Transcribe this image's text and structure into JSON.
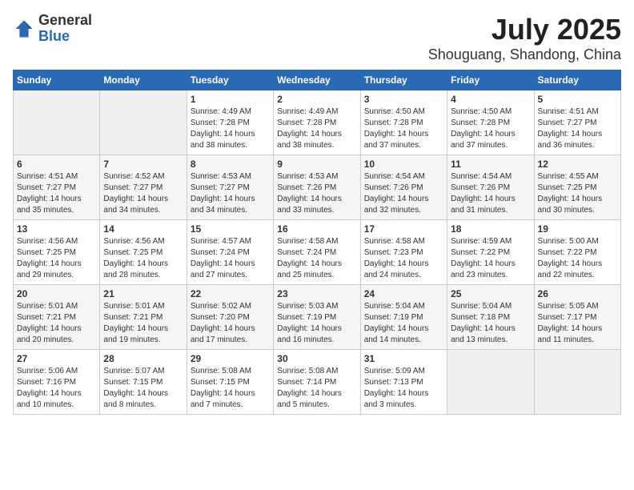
{
  "header": {
    "logo_general": "General",
    "logo_blue": "Blue",
    "title": "July 2025",
    "subtitle": "Shouguang, Shandong, China"
  },
  "days_of_week": [
    "Sunday",
    "Monday",
    "Tuesday",
    "Wednesday",
    "Thursday",
    "Friday",
    "Saturday"
  ],
  "weeks": [
    [
      {
        "day": "",
        "empty": true
      },
      {
        "day": "",
        "empty": true
      },
      {
        "day": "1",
        "sunrise": "Sunrise: 4:49 AM",
        "sunset": "Sunset: 7:28 PM",
        "daylight": "Daylight: 14 hours and 38 minutes."
      },
      {
        "day": "2",
        "sunrise": "Sunrise: 4:49 AM",
        "sunset": "Sunset: 7:28 PM",
        "daylight": "Daylight: 14 hours and 38 minutes."
      },
      {
        "day": "3",
        "sunrise": "Sunrise: 4:50 AM",
        "sunset": "Sunset: 7:28 PM",
        "daylight": "Daylight: 14 hours and 37 minutes."
      },
      {
        "day": "4",
        "sunrise": "Sunrise: 4:50 AM",
        "sunset": "Sunset: 7:28 PM",
        "daylight": "Daylight: 14 hours and 37 minutes."
      },
      {
        "day": "5",
        "sunrise": "Sunrise: 4:51 AM",
        "sunset": "Sunset: 7:27 PM",
        "daylight": "Daylight: 14 hours and 36 minutes."
      }
    ],
    [
      {
        "day": "6",
        "sunrise": "Sunrise: 4:51 AM",
        "sunset": "Sunset: 7:27 PM",
        "daylight": "Daylight: 14 hours and 35 minutes."
      },
      {
        "day": "7",
        "sunrise": "Sunrise: 4:52 AM",
        "sunset": "Sunset: 7:27 PM",
        "daylight": "Daylight: 14 hours and 34 minutes."
      },
      {
        "day": "8",
        "sunrise": "Sunrise: 4:53 AM",
        "sunset": "Sunset: 7:27 PM",
        "daylight": "Daylight: 14 hours and 34 minutes."
      },
      {
        "day": "9",
        "sunrise": "Sunrise: 4:53 AM",
        "sunset": "Sunset: 7:26 PM",
        "daylight": "Daylight: 14 hours and 33 minutes."
      },
      {
        "day": "10",
        "sunrise": "Sunrise: 4:54 AM",
        "sunset": "Sunset: 7:26 PM",
        "daylight": "Daylight: 14 hours and 32 minutes."
      },
      {
        "day": "11",
        "sunrise": "Sunrise: 4:54 AM",
        "sunset": "Sunset: 7:26 PM",
        "daylight": "Daylight: 14 hours and 31 minutes."
      },
      {
        "day": "12",
        "sunrise": "Sunrise: 4:55 AM",
        "sunset": "Sunset: 7:25 PM",
        "daylight": "Daylight: 14 hours and 30 minutes."
      }
    ],
    [
      {
        "day": "13",
        "sunrise": "Sunrise: 4:56 AM",
        "sunset": "Sunset: 7:25 PM",
        "daylight": "Daylight: 14 hours and 29 minutes."
      },
      {
        "day": "14",
        "sunrise": "Sunrise: 4:56 AM",
        "sunset": "Sunset: 7:25 PM",
        "daylight": "Daylight: 14 hours and 28 minutes."
      },
      {
        "day": "15",
        "sunrise": "Sunrise: 4:57 AM",
        "sunset": "Sunset: 7:24 PM",
        "daylight": "Daylight: 14 hours and 27 minutes."
      },
      {
        "day": "16",
        "sunrise": "Sunrise: 4:58 AM",
        "sunset": "Sunset: 7:24 PM",
        "daylight": "Daylight: 14 hours and 25 minutes."
      },
      {
        "day": "17",
        "sunrise": "Sunrise: 4:58 AM",
        "sunset": "Sunset: 7:23 PM",
        "daylight": "Daylight: 14 hours and 24 minutes."
      },
      {
        "day": "18",
        "sunrise": "Sunrise: 4:59 AM",
        "sunset": "Sunset: 7:22 PM",
        "daylight": "Daylight: 14 hours and 23 minutes."
      },
      {
        "day": "19",
        "sunrise": "Sunrise: 5:00 AM",
        "sunset": "Sunset: 7:22 PM",
        "daylight": "Daylight: 14 hours and 22 minutes."
      }
    ],
    [
      {
        "day": "20",
        "sunrise": "Sunrise: 5:01 AM",
        "sunset": "Sunset: 7:21 PM",
        "daylight": "Daylight: 14 hours and 20 minutes."
      },
      {
        "day": "21",
        "sunrise": "Sunrise: 5:01 AM",
        "sunset": "Sunset: 7:21 PM",
        "daylight": "Daylight: 14 hours and 19 minutes."
      },
      {
        "day": "22",
        "sunrise": "Sunrise: 5:02 AM",
        "sunset": "Sunset: 7:20 PM",
        "daylight": "Daylight: 14 hours and 17 minutes."
      },
      {
        "day": "23",
        "sunrise": "Sunrise: 5:03 AM",
        "sunset": "Sunset: 7:19 PM",
        "daylight": "Daylight: 14 hours and 16 minutes."
      },
      {
        "day": "24",
        "sunrise": "Sunrise: 5:04 AM",
        "sunset": "Sunset: 7:19 PM",
        "daylight": "Daylight: 14 hours and 14 minutes."
      },
      {
        "day": "25",
        "sunrise": "Sunrise: 5:04 AM",
        "sunset": "Sunset: 7:18 PM",
        "daylight": "Daylight: 14 hours and 13 minutes."
      },
      {
        "day": "26",
        "sunrise": "Sunrise: 5:05 AM",
        "sunset": "Sunset: 7:17 PM",
        "daylight": "Daylight: 14 hours and 11 minutes."
      }
    ],
    [
      {
        "day": "27",
        "sunrise": "Sunrise: 5:06 AM",
        "sunset": "Sunset: 7:16 PM",
        "daylight": "Daylight: 14 hours and 10 minutes."
      },
      {
        "day": "28",
        "sunrise": "Sunrise: 5:07 AM",
        "sunset": "Sunset: 7:15 PM",
        "daylight": "Daylight: 14 hours and 8 minutes."
      },
      {
        "day": "29",
        "sunrise": "Sunrise: 5:08 AM",
        "sunset": "Sunset: 7:15 PM",
        "daylight": "Daylight: 14 hours and 7 minutes."
      },
      {
        "day": "30",
        "sunrise": "Sunrise: 5:08 AM",
        "sunset": "Sunset: 7:14 PM",
        "daylight": "Daylight: 14 hours and 5 minutes."
      },
      {
        "day": "31",
        "sunrise": "Sunrise: 5:09 AM",
        "sunset": "Sunset: 7:13 PM",
        "daylight": "Daylight: 14 hours and 3 minutes."
      },
      {
        "day": "",
        "empty": true
      },
      {
        "day": "",
        "empty": true
      }
    ]
  ]
}
